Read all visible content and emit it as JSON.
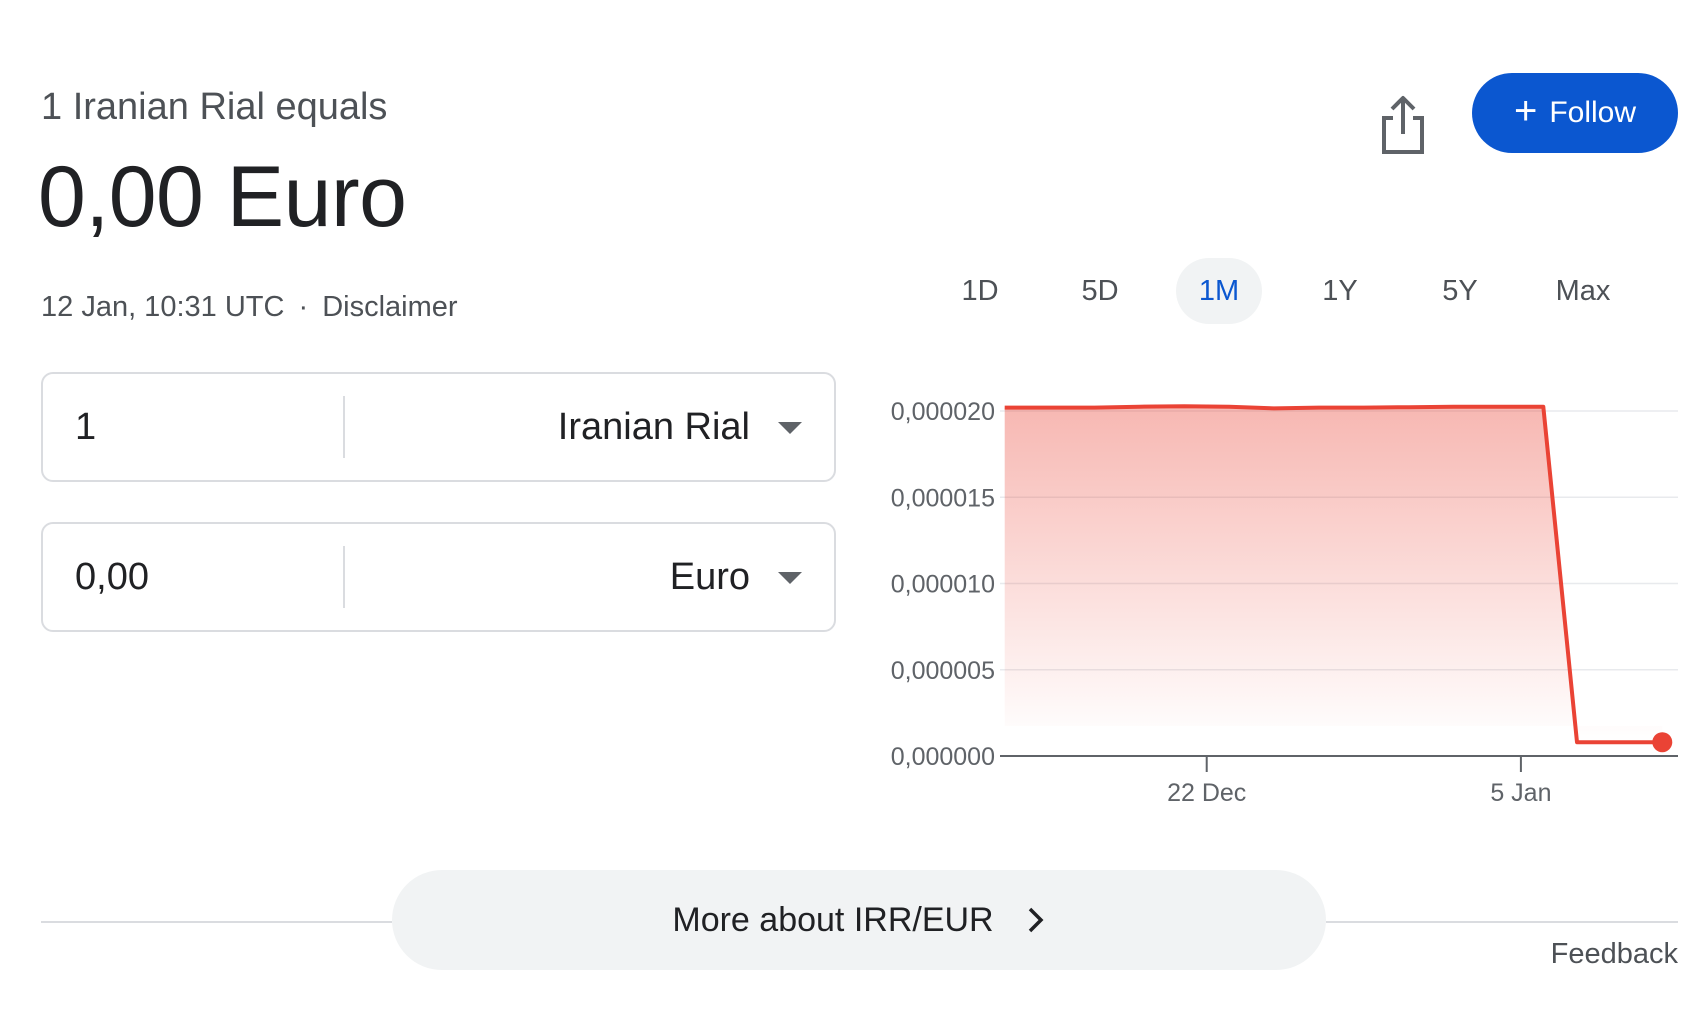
{
  "header": {
    "equals_text": "1 Iranian Rial equals",
    "result_text": "0,00 Euro",
    "timestamp": "12 Jan, 10:31 UTC",
    "separator": "·",
    "disclaimer": "Disclaimer",
    "follow_label": "Follow",
    "follow_icon": "plus-icon",
    "share_icon": "share-icon",
    "accent_color": "#0b57d0"
  },
  "converter": {
    "from": {
      "amount": "1",
      "currency": "Iranian Rial"
    },
    "to": {
      "amount": "0,00",
      "currency": "Euro"
    }
  },
  "range_tabs": [
    {
      "label": "1D",
      "active": false
    },
    {
      "label": "5D",
      "active": false
    },
    {
      "label": "1M",
      "active": true
    },
    {
      "label": "1Y",
      "active": false
    },
    {
      "label": "5Y",
      "active": false
    },
    {
      "label": "Max",
      "active": false
    }
  ],
  "chart_data": {
    "type": "area",
    "line_color": "#ea4335",
    "ylim": [
      0,
      2e-05
    ],
    "y_ticks": [
      {
        "value": 2e-05,
        "label": "0,000020"
      },
      {
        "value": 1.5e-05,
        "label": "0,000015"
      },
      {
        "value": 1e-05,
        "label": "0,000010"
      },
      {
        "value": 5e-06,
        "label": "0,000005"
      },
      {
        "value": 0,
        "label": "0,000000"
      }
    ],
    "x_ticks": [
      {
        "value": 9,
        "label": "22 Dec"
      },
      {
        "value": 23,
        "label": "5 Jan"
      }
    ],
    "xlim": [
      -0.3,
      30
    ],
    "series": [
      {
        "x": [
          0,
          2,
          4,
          6,
          8,
          10,
          12,
          14,
          16,
          18,
          20,
          22,
          24,
          25.5,
          27,
          28.5,
          29.3
        ],
        "y": [
          2.02e-05,
          2.02e-05,
          2.02e-05,
          2.025e-05,
          2.028e-05,
          2.025e-05,
          2.015e-05,
          2.02e-05,
          2.02e-05,
          2.022e-05,
          2.025e-05,
          2.025e-05,
          2.025e-05,
          8e-07,
          8e-07,
          8e-07,
          8e-07
        ]
      }
    ],
    "grid": true
  },
  "footer": {
    "more_label": "More about IRR/EUR",
    "more_icon": "chevron-right-icon",
    "feedback": "Feedback"
  }
}
